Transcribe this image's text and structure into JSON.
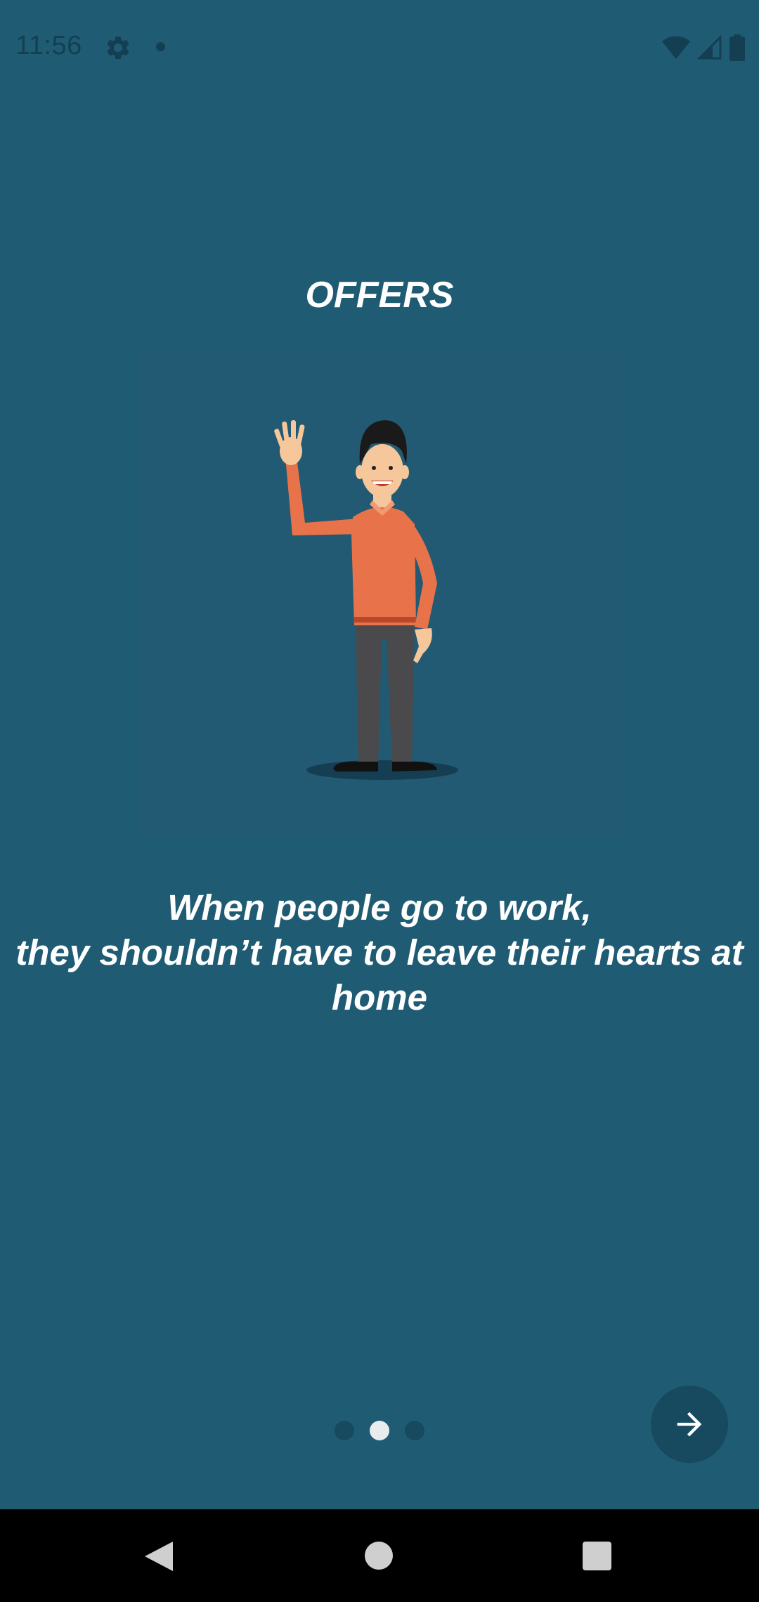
{
  "status_bar": {
    "time": "11:56",
    "icons": [
      "gear-icon",
      "notification-dot",
      "wifi-icon",
      "cellular-signal-icon",
      "battery-icon"
    ]
  },
  "onboarding": {
    "title": "OFFERS",
    "message_lines": [
      "When people go to work,",
      "they shouldn’t have to leave their hearts at",
      "home"
    ],
    "illustration": "man-waving-illustration",
    "page_indicator": {
      "total": 3,
      "current": 2
    },
    "next_button_icon": "arrow-right-icon"
  },
  "navigation_bar": {
    "buttons": [
      "back-icon",
      "home-icon",
      "recents-icon"
    ]
  },
  "colors": {
    "background": "#1f5c74",
    "panel": "#225a73",
    "text": "#ffffff",
    "dot_active": "#e8ecee",
    "dot_inactive": "#174a5e",
    "shirt": "#e8734a",
    "pants": "#4a4a4c"
  }
}
